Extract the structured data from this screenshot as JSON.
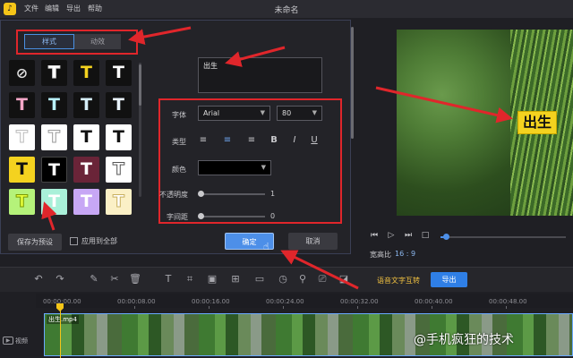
{
  "app": {
    "title": "未命名",
    "menu": [
      "文件",
      "编辑",
      "导出",
      "帮助"
    ],
    "logo_glyph": "♪",
    "accent": "#4d8fe8",
    "annotation_color": "#e0262b"
  },
  "editor": {
    "tabs": [
      "样式",
      "动效"
    ],
    "text_value": "出生",
    "font_label": "字体",
    "font_value": "Arial",
    "size_value": "80",
    "type_label": "类型",
    "color_label": "颜色",
    "opacity_label": "不透明度",
    "opacity_value": "1",
    "spacing_label": "字间距",
    "spacing_value": "0",
    "format_icons": [
      "align-left-icon",
      "align-center-icon",
      "align-right-icon",
      "bold-icon",
      "italic-icon",
      "underline-icon"
    ],
    "format_glyphs": [
      "≡",
      "≡",
      "≡",
      "B",
      "I",
      "U"
    ],
    "save_preset": "保存为预设",
    "apply_all": "应用到全部",
    "ok": "确定",
    "cancel": "取消"
  },
  "presets": {
    "glyph": "T",
    "no_style_glyph": "⊘"
  },
  "preview": {
    "caption": "出生",
    "aspect_label": "宽高比",
    "aspect_value": "16 : 9"
  },
  "toolbar": {
    "speech_to_text": "语音文字互转",
    "export": "导出"
  },
  "timeline": {
    "ticks": [
      "00:00:00.00",
      "00:00:08.00",
      "00:00:16.00",
      "00:00:24.00",
      "00:00:32.00",
      "00:00:40.00",
      "00:00:48.00"
    ],
    "track_label": "视频",
    "clip_name": "出生.mp4"
  },
  "watermark": "@手机疯狂的技术"
}
